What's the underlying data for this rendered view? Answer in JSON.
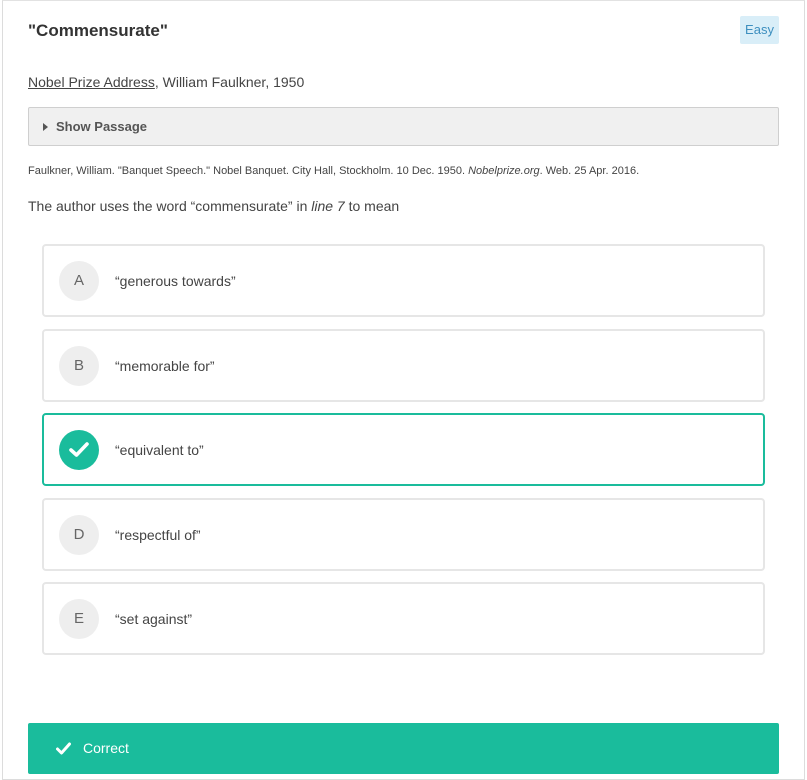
{
  "question": {
    "title": "\"Commensurate\"",
    "difficulty": "Easy",
    "source_link": "Nobel Prize Address",
    "source_rest": ", William Faulkner, 1950",
    "show_passage_label": "Show Passage",
    "citation_part1": "Faulkner, William. \"Banquet Speech.\" Nobel Banquet. City Hall, Stockholm. 10 Dec. 1950. ",
    "citation_italic": "Nobelprize.org",
    "citation_part2": ". Web. 25 Apr. 2016.",
    "prompt_part1": "The author uses the word “commensurate” in ",
    "prompt_italic": "line 7",
    "prompt_part2": " to mean"
  },
  "choices": [
    {
      "letter": "A",
      "text": "“generous towards”",
      "selected": false
    },
    {
      "letter": "B",
      "text": "“memorable for”",
      "selected": false
    },
    {
      "letter": "C",
      "text": "“equivalent to”",
      "selected": true
    },
    {
      "letter": "D",
      "text": "“respectful of”",
      "selected": false
    },
    {
      "letter": "E",
      "text": "“set against”",
      "selected": false
    }
  ],
  "result": {
    "label": "Correct",
    "icon": "check-icon"
  },
  "colors": {
    "accent": "#1abc9c",
    "badge_bg": "#d9eef8",
    "badge_text": "#3d8fbf"
  }
}
